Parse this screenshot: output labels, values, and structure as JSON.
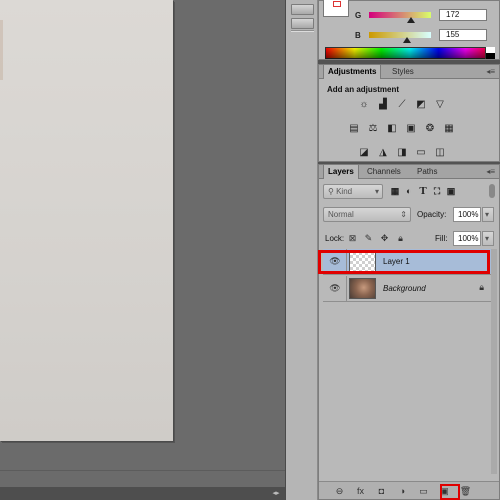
{
  "color_panel": {
    "channels": [
      {
        "label": "G",
        "value": "172",
        "knob": 0.67
      },
      {
        "label": "B",
        "value": "155",
        "knob": 0.61
      }
    ]
  },
  "adjustments": {
    "tabs": [
      {
        "label": "Adjustments",
        "active": true
      },
      {
        "label": "Styles",
        "active": false
      }
    ],
    "title": "Add an adjustment",
    "rows": [
      [
        "brightness-contrast-icon",
        "levels-icon",
        "curves-icon",
        "exposure-icon",
        "vibrance-icon"
      ],
      [
        "hue-saturation-icon",
        "color-balance-icon",
        "black-white-icon",
        "photo-filter-icon",
        "channel-mixer-icon",
        "color-lookup-icon"
      ],
      [
        "invert-icon",
        "posterize-icon",
        "threshold-icon",
        "gradient-map-icon",
        "selective-color-icon"
      ]
    ]
  },
  "layers": {
    "tabs": [
      {
        "label": "Layers",
        "active": true
      },
      {
        "label": "Channels",
        "active": false
      },
      {
        "label": "Paths",
        "active": false
      }
    ],
    "filter_label": "Kind",
    "blend_mode": "Normal",
    "opacity_label": "Opacity:",
    "opacity_value": "100%",
    "lock_label": "Lock:",
    "fill_label": "Fill:",
    "fill_value": "100%",
    "items": [
      {
        "name": "Layer 1",
        "selected": true,
        "italic": false,
        "locked": false
      },
      {
        "name": "Background",
        "selected": false,
        "italic": true,
        "locked": true
      }
    ],
    "footer_icons": [
      "link-icon",
      "fx-icon",
      "mask-icon",
      "adjustment-layer-icon",
      "group-folder-icon",
      "new-layer-icon",
      "trash-icon"
    ]
  },
  "colors": {
    "highlight": "#e00000",
    "selected_row": "#a7bcd8"
  }
}
